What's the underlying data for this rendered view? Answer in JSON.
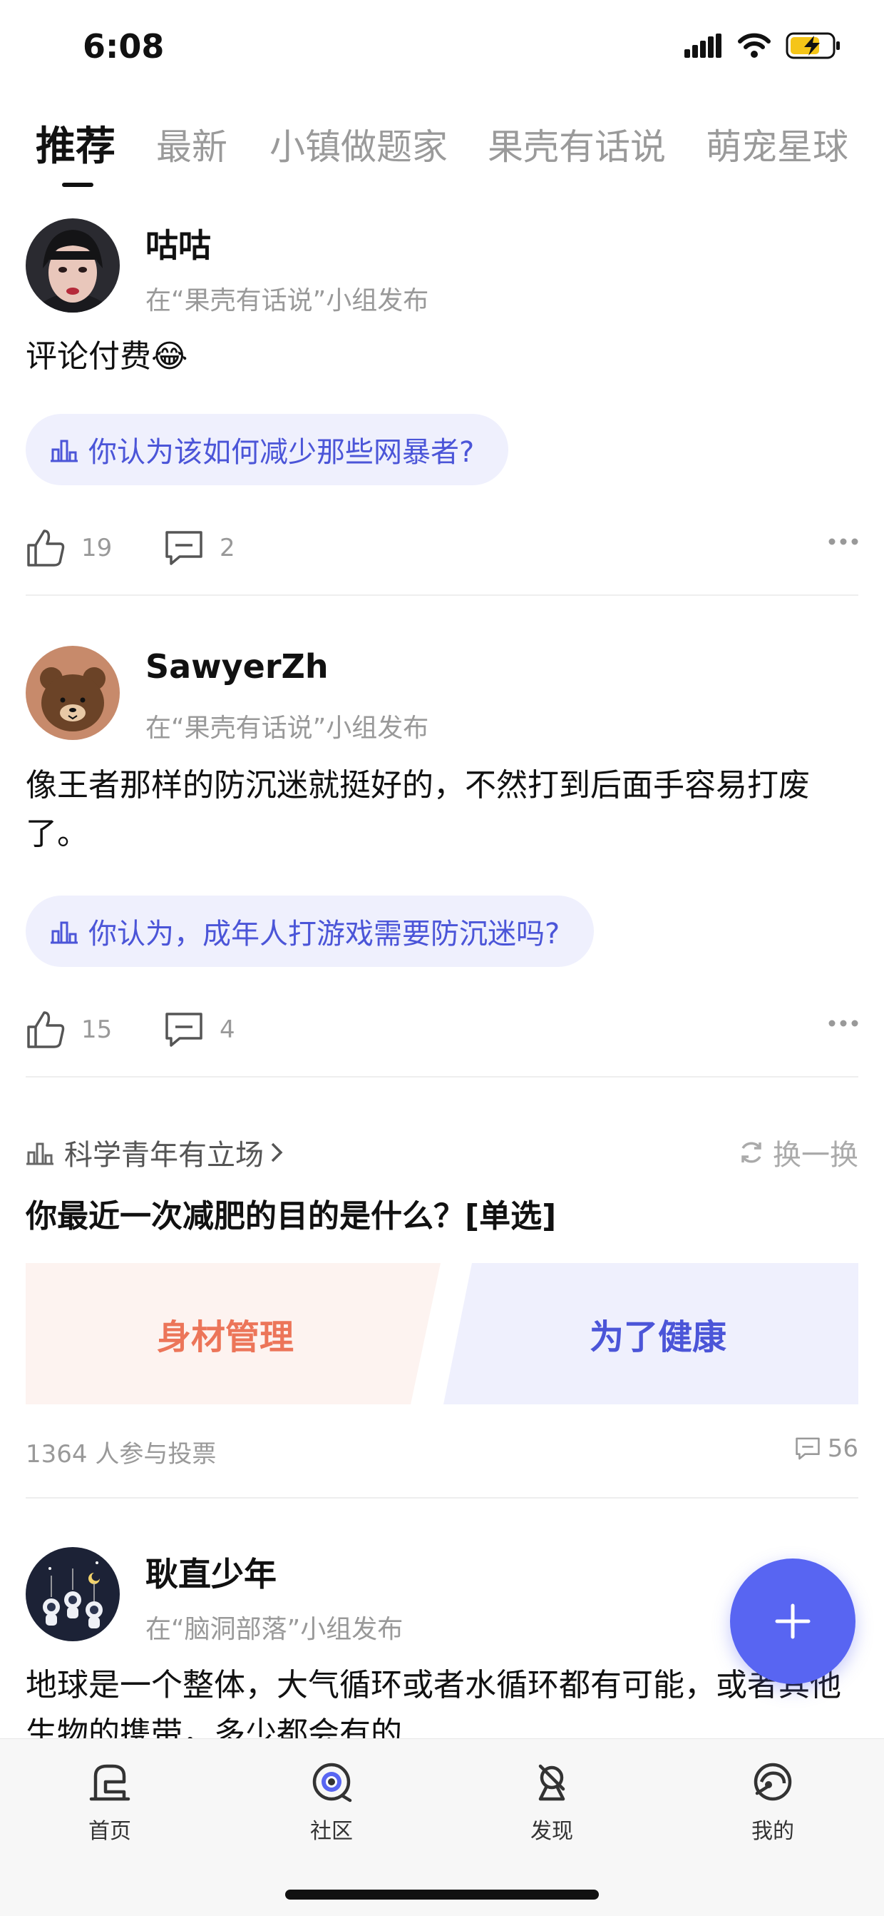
{
  "status_bar": {
    "time": "6:08",
    "icons": [
      "signal-icon",
      "wifi-icon",
      "battery-charging-icon"
    ]
  },
  "tabs": [
    {
      "label": "推荐",
      "active": true
    },
    {
      "label": "最新",
      "active": false
    },
    {
      "label": "小镇做题家",
      "active": false
    },
    {
      "label": "果壳有话说",
      "active": false
    },
    {
      "label": "萌宠星球",
      "active": false
    }
  ],
  "posts": [
    {
      "author": "咕咕",
      "group_line": "在“果壳有话说”小组发布",
      "text": "评论付费😂",
      "topic": "你认为该如何减少那些网暴者?",
      "likes": "19",
      "comments": "2"
    },
    {
      "author": "SawyerZh",
      "group_line": "在“果壳有话说”小组发布",
      "text": "像王者那样的防沉迷就挺好的，不然打到后面手容易打废了。",
      "topic": "你认为，成年人打游戏需要防沉迷吗?",
      "likes": "15",
      "comments": "4"
    },
    {
      "author": "耿直少年",
      "group_line": "在“脑洞部落”小组发布",
      "text": "地球是一个整体，大气循环或者水循环都有可能，或者其他生物的携带，多少都会有的"
    }
  ],
  "poll": {
    "group": "科学青年有立场",
    "swap_label": "换一换",
    "question": "你最近一次减肥的目的是什么？[单选]",
    "options": [
      "身材管理",
      "为了健康"
    ],
    "participants": "1364 人参与投票",
    "comment_count": "56",
    "colors": {
      "left_bg": "#fdf3f0",
      "left_text": "#ec7559",
      "right_bg": "#eff0fd",
      "right_text": "#4b55d8"
    }
  },
  "fab": {
    "icon": "plus-icon",
    "color": "#5865f2"
  },
  "bottom_nav": [
    {
      "label": "首页",
      "icon": "home-icon",
      "active": false
    },
    {
      "label": "社区",
      "icon": "community-icon",
      "active": true
    },
    {
      "label": "发现",
      "icon": "discover-icon",
      "active": false
    },
    {
      "label": "我的",
      "icon": "profile-icon",
      "active": false
    }
  ]
}
